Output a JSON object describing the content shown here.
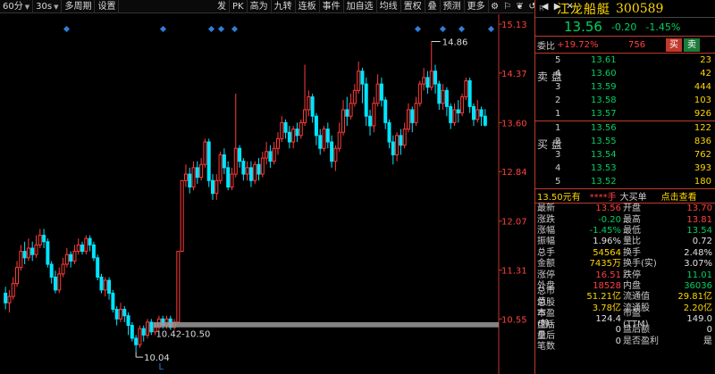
{
  "toolbar": {
    "items": [
      "60分",
      "30s",
      "多周期",
      "设置"
    ],
    "right_items": [
      "发",
      "PK",
      "高为",
      "九转",
      "连板",
      "事件",
      "加自选",
      "均线",
      "置权",
      "叠",
      "预测",
      "更多"
    ]
  },
  "chart_data": {
    "type": "candlestick",
    "price_axis": [
      "15.13",
      "14.37",
      "13.60",
      "12.84",
      "12.07",
      "11.31",
      "10.55"
    ],
    "price_range": [
      10.0,
      15.2
    ],
    "annotations": {
      "high_label": "14.86",
      "low_label": "10.04",
      "range_label": "10.42-10.50",
      "bottom_marker": "L"
    },
    "up_color": "#ff3b3b",
    "down_color": "#00e5ff",
    "candles": [
      [
        10.95,
        10.8,
        11.05,
        10.7
      ],
      [
        10.8,
        10.9,
        11.0,
        10.65
      ],
      [
        10.9,
        11.1,
        11.2,
        10.85
      ],
      [
        11.1,
        11.35,
        11.45,
        11.05
      ],
      [
        11.35,
        11.6,
        11.7,
        11.3
      ],
      [
        11.6,
        11.5,
        11.75,
        11.4
      ],
      [
        11.5,
        11.65,
        11.8,
        11.45
      ],
      [
        11.65,
        11.55,
        11.75,
        11.45
      ],
      [
        11.55,
        11.7,
        11.85,
        11.5
      ],
      [
        11.7,
        11.85,
        11.95,
        11.65
      ],
      [
        11.85,
        11.75,
        11.95,
        11.65
      ],
      [
        11.75,
        11.4,
        11.8,
        11.35
      ],
      [
        11.4,
        11.2,
        11.45,
        11.1
      ],
      [
        11.2,
        11.0,
        11.3,
        10.95
      ],
      [
        11.0,
        11.25,
        11.35,
        10.95
      ],
      [
        11.25,
        11.4,
        11.5,
        11.2
      ],
      [
        11.4,
        11.55,
        11.65,
        11.35
      ],
      [
        11.55,
        11.45,
        11.6,
        11.35
      ],
      [
        11.45,
        11.6,
        11.7,
        11.4
      ],
      [
        11.6,
        11.7,
        11.8,
        11.55
      ],
      [
        11.7,
        11.6,
        11.75,
        11.55
      ],
      [
        11.6,
        11.8,
        11.85,
        11.55
      ],
      [
        11.8,
        11.7,
        11.85,
        11.6
      ],
      [
        11.7,
        11.5,
        11.75,
        11.45
      ],
      [
        11.5,
        11.2,
        11.55,
        11.15
      ],
      [
        11.2,
        11.0,
        11.25,
        10.95
      ],
      [
        11.0,
        11.15,
        11.2,
        10.9
      ],
      [
        11.15,
        10.95,
        11.2,
        10.85
      ],
      [
        10.95,
        10.7,
        11.0,
        10.65
      ],
      [
        10.7,
        10.55,
        10.75,
        10.45
      ],
      [
        10.55,
        10.7,
        10.8,
        10.5
      ],
      [
        10.7,
        10.6,
        10.75,
        10.5
      ],
      [
        10.6,
        10.45,
        10.65,
        10.3
      ],
      [
        10.45,
        10.25,
        10.5,
        10.2
      ],
      [
        10.25,
        10.15,
        10.3,
        10.04
      ],
      [
        10.15,
        10.4,
        10.45,
        10.1
      ],
      [
        10.4,
        10.3,
        10.45,
        10.2
      ],
      [
        10.3,
        10.5,
        10.55,
        10.25
      ],
      [
        10.5,
        10.35,
        10.55,
        10.3
      ],
      [
        10.35,
        10.42,
        10.5,
        10.3
      ],
      [
        10.42,
        10.55,
        10.6,
        10.38
      ],
      [
        10.55,
        10.45,
        10.6,
        10.4
      ],
      [
        10.45,
        10.55,
        10.6,
        10.4
      ],
      [
        10.55,
        10.42,
        10.6,
        10.38
      ],
      [
        10.42,
        10.5,
        10.55,
        10.38
      ],
      [
        10.5,
        11.6,
        11.6,
        10.5
      ],
      [
        11.6,
        12.7,
        12.7,
        11.6
      ],
      [
        12.7,
        12.8,
        12.95,
        12.6
      ],
      [
        12.8,
        12.6,
        12.9,
        12.5
      ],
      [
        12.6,
        12.9,
        13.0,
        12.55
      ],
      [
        12.9,
        12.75,
        13.0,
        12.65
      ],
      [
        12.75,
        12.95,
        13.05,
        12.7
      ],
      [
        12.95,
        13.3,
        13.35,
        12.9
      ],
      [
        13.3,
        12.7,
        13.35,
        12.6
      ],
      [
        12.7,
        12.5,
        12.8,
        12.4
      ],
      [
        12.5,
        12.7,
        12.8,
        12.4
      ],
      [
        12.7,
        13.1,
        13.15,
        12.65
      ],
      [
        13.1,
        12.9,
        13.2,
        12.8
      ],
      [
        12.9,
        12.6,
        13.0,
        12.55
      ],
      [
        12.6,
        12.8,
        12.9,
        12.55
      ],
      [
        12.8,
        13.2,
        14.05,
        12.75
      ],
      [
        13.2,
        13.0,
        13.25,
        12.9
      ],
      [
        13.0,
        12.8,
        13.05,
        12.7
      ],
      [
        12.8,
        12.9,
        13.0,
        12.7
      ],
      [
        12.9,
        12.7,
        13.0,
        12.6
      ],
      [
        12.7,
        12.95,
        13.0,
        12.65
      ],
      [
        12.95,
        12.8,
        13.05,
        12.7
      ],
      [
        12.8,
        13.05,
        13.15,
        12.75
      ],
      [
        13.05,
        13.15,
        13.3,
        12.95
      ],
      [
        13.15,
        13.0,
        13.25,
        12.9
      ],
      [
        13.0,
        13.2,
        13.3,
        12.95
      ],
      [
        13.2,
        13.35,
        13.45,
        13.1
      ],
      [
        13.35,
        13.6,
        13.7,
        13.3
      ],
      [
        13.6,
        13.45,
        13.65,
        13.35
      ],
      [
        13.45,
        13.3,
        13.55,
        13.2
      ],
      [
        13.3,
        13.5,
        13.55,
        13.2
      ],
      [
        13.5,
        13.4,
        13.6,
        13.3
      ],
      [
        13.4,
        13.6,
        13.65,
        13.35
      ],
      [
        13.6,
        13.8,
        14.5,
        13.55
      ],
      [
        13.8,
        14.0,
        14.1,
        13.7
      ],
      [
        14.0,
        13.7,
        14.05,
        13.6
      ],
      [
        13.7,
        13.4,
        13.75,
        13.25
      ],
      [
        13.4,
        13.2,
        13.5,
        13.1
      ],
      [
        13.2,
        13.5,
        13.55,
        13.15
      ],
      [
        13.5,
        13.3,
        13.6,
        13.2
      ],
      [
        13.3,
        13.0,
        13.4,
        12.9
      ],
      [
        13.0,
        13.2,
        13.25,
        12.85
      ],
      [
        13.2,
        13.45,
        13.6,
        13.15
      ],
      [
        13.45,
        13.8,
        13.95,
        13.4
      ],
      [
        13.8,
        13.7,
        14.0,
        13.55
      ],
      [
        13.7,
        13.9,
        14.05,
        13.65
      ],
      [
        13.9,
        14.1,
        14.2,
        13.85
      ],
      [
        14.1,
        14.4,
        14.55,
        14.05
      ],
      [
        14.4,
        14.2,
        14.45,
        13.9
      ],
      [
        14.2,
        13.7,
        14.3,
        13.55
      ],
      [
        13.7,
        13.55,
        13.8,
        13.4
      ],
      [
        13.55,
        13.9,
        14.0,
        13.45
      ],
      [
        13.9,
        14.2,
        14.35,
        13.85
      ],
      [
        14.2,
        13.95,
        14.3,
        13.85
      ],
      [
        13.95,
        13.6,
        14.0,
        13.5
      ],
      [
        13.6,
        13.3,
        13.65,
        13.2
      ],
      [
        13.3,
        13.1,
        13.4,
        12.95
      ],
      [
        13.1,
        13.4,
        13.45,
        13.0
      ],
      [
        13.4,
        13.25,
        13.5,
        13.1
      ],
      [
        13.25,
        13.5,
        13.6,
        13.2
      ],
      [
        13.5,
        13.8,
        13.9,
        13.45
      ],
      [
        13.8,
        13.6,
        13.85,
        13.45
      ],
      [
        13.6,
        13.9,
        14.0,
        13.55
      ],
      [
        13.9,
        14.2,
        14.25,
        13.85
      ],
      [
        14.2,
        14.3,
        14.45,
        14.1
      ],
      [
        14.3,
        14.15,
        14.4,
        14.05
      ],
      [
        14.15,
        14.4,
        14.86,
        14.1
      ],
      [
        14.4,
        14.2,
        14.5,
        14.05
      ],
      [
        14.2,
        13.9,
        14.25,
        13.8
      ],
      [
        13.9,
        14.1,
        14.2,
        13.8
      ],
      [
        14.1,
        13.85,
        14.15,
        13.7
      ],
      [
        13.85,
        13.6,
        13.9,
        13.5
      ],
      [
        13.6,
        13.8,
        13.9,
        13.55
      ],
      [
        13.8,
        13.75,
        13.95,
        13.6
      ],
      [
        13.75,
        14.0,
        14.05,
        13.7
      ],
      [
        14.0,
        14.25,
        14.3,
        13.95
      ],
      [
        14.25,
        13.85,
        14.3,
        13.75
      ],
      [
        13.85,
        13.65,
        13.9,
        13.55
      ],
      [
        13.65,
        13.8,
        13.95,
        13.6
      ],
      [
        13.8,
        13.7,
        13.85,
        13.55
      ],
      [
        13.7,
        13.56,
        13.81,
        13.54
      ]
    ]
  },
  "quote": {
    "r_tag": "R",
    "name": "江龙船艇",
    "code": "300589",
    "price": "13.56",
    "change": "-0.20",
    "change_pct": "-1.45%",
    "wb_label": "委比",
    "wb_pct": "+19.72%",
    "wb_num": "756",
    "buy_btn": "买",
    "sell_btn": "卖",
    "sell_side": "卖 盘",
    "buy_side": "买 盘",
    "asks": [
      {
        "lv": "5",
        "price": "13.61",
        "vol": "23"
      },
      {
        "lv": "4",
        "price": "13.60",
        "vol": "42"
      },
      {
        "lv": "3",
        "price": "13.59",
        "vol": "444"
      },
      {
        "lv": "2",
        "price": "13.58",
        "vol": "103"
      },
      {
        "lv": "1",
        "price": "13.57",
        "vol": "926"
      }
    ],
    "bids": [
      {
        "lv": "1",
        "price": "13.56",
        "vol": "122"
      },
      {
        "lv": "2",
        "price": "13.55",
        "vol": "836"
      },
      {
        "lv": "3",
        "price": "13.54",
        "vol": "762"
      },
      {
        "lv": "4",
        "price": "13.53",
        "vol": "393"
      },
      {
        "lv": "5",
        "price": "13.52",
        "vol": "180"
      }
    ],
    "large_order": {
      "a": "13.50元有",
      "b": "****手",
      "c": "大买单",
      "d": "点击查看"
    },
    "stats": [
      [
        "最新",
        "13.56",
        "red",
        "开盘",
        "13.70",
        "red"
      ],
      [
        "涨跌",
        "-0.20",
        "grn",
        "最高",
        "13.81",
        "red"
      ],
      [
        "涨幅",
        "-1.45%",
        "grn",
        "最低",
        "13.54",
        "grn"
      ],
      [
        "振幅",
        "1.96%",
        "wht",
        "量比",
        "0.72",
        "wht"
      ],
      [
        "总手",
        "54564",
        "yel",
        "换手",
        "2.48%",
        "wht"
      ],
      [
        "金额",
        "7435万",
        "yel",
        "换手(实)",
        "3.07%",
        "wht"
      ],
      [
        "涨停",
        "16.51",
        "red",
        "跌停",
        "11.01",
        "grn"
      ],
      [
        "外盘",
        "18528",
        "red",
        "内盘",
        "36036",
        "grn"
      ],
      [
        "总市值",
        "51.21亿",
        "yel",
        "流通值",
        "29.81亿",
        "yel"
      ],
      [
        "总股本",
        "3.78亿",
        "yel",
        "流通股",
        "2.20亿",
        "yel"
      ],
      [
        "市盈(静)",
        "124.4",
        "wht",
        "市盈(TTM)",
        "149.0",
        "wht"
      ],
      [
        "盘后量",
        "0",
        "wht",
        "盘后额",
        "0",
        "wht"
      ],
      [
        "盘后笔数",
        "0",
        "wht",
        "是否盈利",
        "是",
        "wht"
      ]
    ]
  }
}
